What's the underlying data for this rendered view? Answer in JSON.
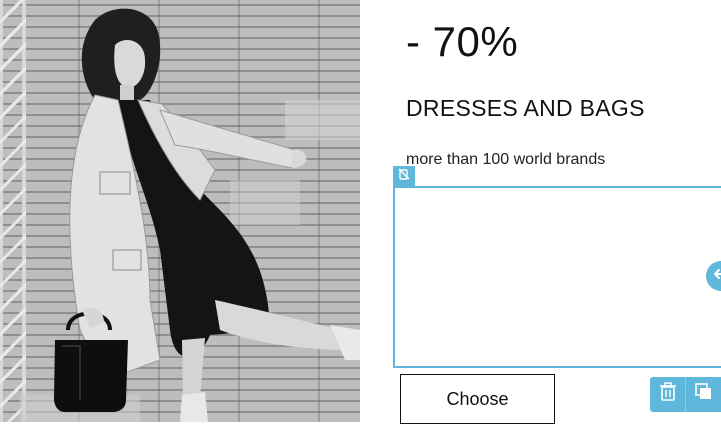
{
  "banner": {
    "discount": "- 70%",
    "headline": "DRESSES AND BAGS",
    "subline": "more than 100 world brands",
    "button_label": "Choose"
  },
  "image": {
    "alt": "Woman in a light coat and black dress holding a black handbag"
  },
  "editor": {
    "accent_color": "#5fb7dc",
    "icons": [
      "hide-icon",
      "move-arrows-icon",
      "trash-icon",
      "duplicate-icon"
    ]
  }
}
